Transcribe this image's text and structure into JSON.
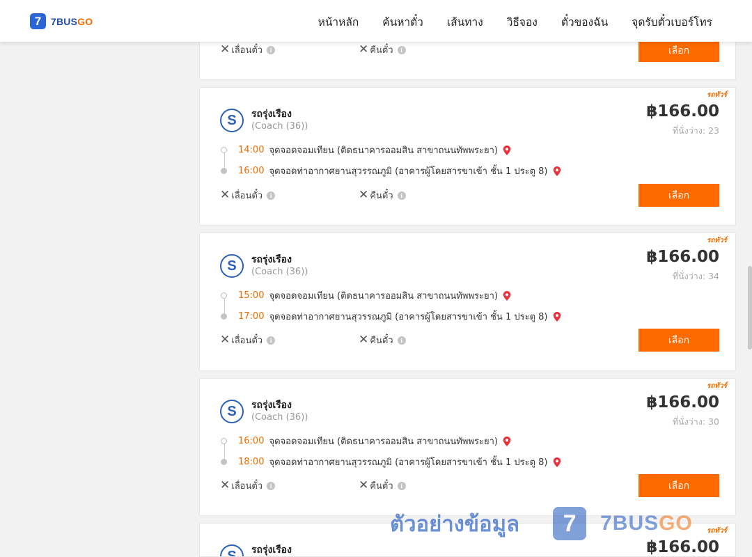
{
  "header": {
    "logo_digit": "7",
    "logo_text_a": "7BUS",
    "logo_text_b": "GO",
    "nav": [
      "หน้าหลัก",
      "ค้นหาตั๋ว",
      "เส้นทาง",
      "วิธีจอง",
      "ตั๋วของฉัน",
      "จุดรับตั๋วเบอร์โทร"
    ]
  },
  "common": {
    "reschedule_label": "เลื่อนตั๋ว",
    "refund_label": "คืนตั๋ว",
    "select_label": "เลือก",
    "vip_tag": "รถทัวร์",
    "seats_label": "ที่นั่งว่าง:",
    "currency_symbol": "฿"
  },
  "trips": [
    {
      "operator": "รถรุ่งเรือง",
      "bus_type": "(Coach (36))",
      "price": "166.00",
      "seats": "23",
      "depart_time": "14:00",
      "depart_place": "จุดจอดจอมเทียน (ติดธนาคารออมสิน สาขาถนนทัพพระยา)",
      "arrive_time": "16:00",
      "arrive_place": "จุดจอดท่าอากาศยานสุวรรณภูมิ (อาคารผู้โดยสารขาเข้า ชั้น 1 ประตู 8)"
    },
    {
      "operator": "รถรุ่งเรือง",
      "bus_type": "(Coach (36))",
      "price": "166.00",
      "seats": "34",
      "depart_time": "15:00",
      "depart_place": "จุดจอดจอมเทียน (ติดธนาคารออมสิน สาขาถนนทัพพระยา)",
      "arrive_time": "17:00",
      "arrive_place": "จุดจอดท่าอากาศยานสุวรรณภูมิ (อาคารผู้โดยสารขาเข้า ชั้น 1 ประตู 8)"
    },
    {
      "operator": "รถรุ่งเรือง",
      "bus_type": "(Coach (36))",
      "price": "166.00",
      "seats": "30",
      "depart_time": "16:00",
      "depart_place": "จุดจอดจอมเทียน (ติดธนาคารออมสิน สาขาถนนทัพพระยา)",
      "arrive_time": "18:00",
      "arrive_place": "จุดจอดท่าอากาศยานสุวรรณภูมิ (อาคารผู้โดยสารขาเข้า ชั้น 1 ประตู 8)"
    },
    {
      "operator": "รถรุ่งเรือง",
      "price": "166.00"
    }
  ],
  "watermark": {
    "text": "ตัวอย่างข้อมูล",
    "badge": "7",
    "brand_a": "7BUS",
    "brand_b": "GO"
  },
  "colors": {
    "accent": "#ff6a00",
    "time": "#ee6c00",
    "brand_blue": "#2a66d6",
    "pin": "#e8333c"
  },
  "icons": {
    "pin": "map-pin-icon",
    "info": "info-icon",
    "close": "x-icon"
  }
}
